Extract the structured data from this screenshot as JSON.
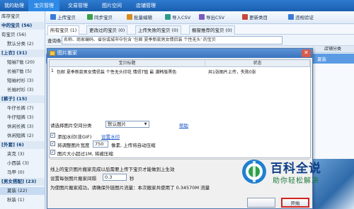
{
  "nav": {
    "items": [
      {
        "label": "我的助理"
      },
      {
        "label": "宝贝管理"
      },
      {
        "label": "交易管理"
      },
      {
        "label": "图片空间"
      },
      {
        "label": "店铺管理"
      }
    ],
    "active_index": 1
  },
  "sidebar": {
    "items": [
      {
        "label": "库存宝贝"
      },
      {
        "label": "中的宝贝 (56)",
        "group": true
      },
      {
        "label": "有宝贝 (56)"
      },
      {
        "label": "默认分类 (2)"
      },
      {
        "label": "[上衣] (31)",
        "group": true
      },
      {
        "label": "短袖T恤 (20)"
      },
      {
        "label": "长袖T恤 (5)"
      },
      {
        "label": "短袖衬衫 (3)"
      },
      {
        "label": "长袖衬衫 (3)"
      },
      {
        "label": "[裤子] (15)",
        "group": true
      },
      {
        "label": "牛仔长裤 (7)"
      },
      {
        "label": "牛仔短裤 (3)"
      },
      {
        "label": "休闲长裤 (3)"
      },
      {
        "label": "休闲短裤 (2)"
      },
      {
        "label": "[外套] (6)",
        "group": true
      },
      {
        "label": "夹克 (3)"
      },
      {
        "label": "小西装 (3)"
      },
      {
        "label": "马甲 (0)"
      },
      {
        "label": "[男女搭配] (23)",
        "group": true
      },
      {
        "label": "夏装 (22)",
        "selected": true
      },
      {
        "label": "秋装 (1)"
      }
    ]
  },
  "toolbar": {
    "buttons": [
      {
        "label": "上传宝贝",
        "color": "#3b7bd6"
      },
      {
        "label": "同步宝贝",
        "color": "#3aa04a"
      },
      {
        "label": "批量编辑",
        "color": "#d98b1f"
      },
      {
        "label": "导入CSV",
        "color": "#2f9a8c"
      },
      {
        "label": "导出CSV",
        "color": "#7a5bc2"
      },
      {
        "label": "更新类目",
        "color": "#c9473a"
      },
      {
        "label": "违规验证",
        "color": "#3b7bd6"
      }
    ]
  },
  "tabs": {
    "items": [
      {
        "label": "所有宝贝 (1)"
      },
      {
        "label": "更改过的宝贝 (0)"
      },
      {
        "label": "上传失败的宝贝 (0)"
      },
      {
        "label": "橱窗推荐的宝贝 (0)"
      }
    ],
    "active_index": 0
  },
  "search": {
    "label": "查询条件",
    "value": "名称、商家编码、省份或城市中包含 '包邮 夏季新款男女情侣装 个性无头' 的宝贝"
  },
  "grid": {
    "header_store_category": "店铺分类",
    "selected_row_text": "夏装"
  },
  "dialog": {
    "title": "图片搬家",
    "close_glyph": "✕",
    "table": {
      "col_title": "宝贝标题",
      "col_status": "状态",
      "rows": [
        {
          "index": "1",
          "title": "包邮 夏季新款男女情侣装 个性无头印花 情侣T恤 最 潮韩版黑色",
          "status": "共1张图片上传，失败0张"
        }
      ]
    },
    "category_label": "请选择图片空间分类",
    "category_value": "默认图片",
    "help_link": "帮助",
    "watermark": {
      "label": "添加水印(非GIF)",
      "link": "设置水印",
      "checked": true
    },
    "resize": {
      "label_before": "将调整图片宽度",
      "value": "750",
      "label_after": "像素, 上传将自动压缩",
      "checked": true
    },
    "oversize": {
      "label": "图片大小超过1M, 将被压缩",
      "checked": true
    },
    "note_line": "线上的宝贝图片搬家完成以后需要上传下宝贝才能做到上生效",
    "interval_label": "设置每张图片搬家间隔",
    "interval_value": "0.3",
    "interval_unit": "秒",
    "summary": "为使图片搬家成功，请确保外链图片流量：本次搬家共使用了 0.34570M 流量",
    "buttons": {
      "cancel": "",
      "ok": "开始"
    }
  },
  "watermark_overlay": {
    "title": "百科全说",
    "subtitle": "助你轻松解决"
  }
}
